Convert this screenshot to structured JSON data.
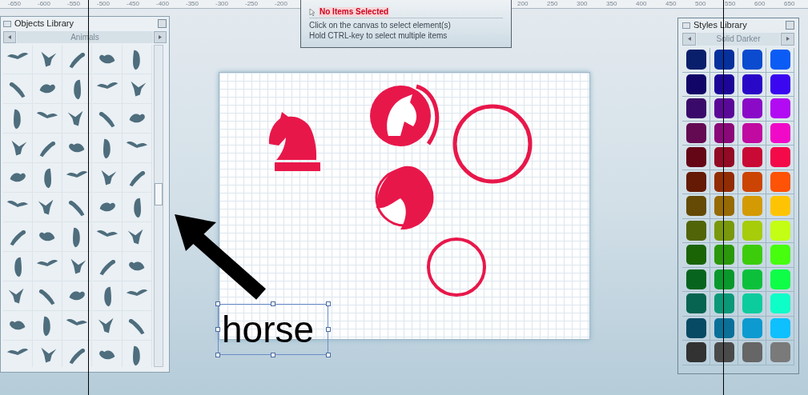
{
  "ruler": {
    "left_labels": [
      "-650",
      "-600",
      "-550",
      "-500",
      "-450",
      "-400",
      "-350",
      "-300",
      "-250",
      "-200"
    ],
    "right_labels": [
      "200",
      "250",
      "300",
      "350",
      "400",
      "450",
      "500",
      "550",
      "600",
      "650"
    ]
  },
  "objects_library": {
    "title": "Objects Library",
    "category": "Animals"
  },
  "selection_panel": {
    "status": "No Items Selected",
    "hints": [
      "Click on the canvas to select element(s)",
      "Hold CTRL-key to select multiple items"
    ]
  },
  "canvas": {
    "text_object": {
      "text": "horse",
      "selected": true
    }
  },
  "styles_library": {
    "title": "Styles Library",
    "category": "Solid Darker",
    "swatches": [
      {
        "color": "#0a1f6b"
      },
      {
        "color": "#06309c"
      },
      {
        "color": "#0a4bd0"
      },
      {
        "color": "#0b5cf5"
      },
      {
        "color": "#110667"
      },
      {
        "color": "#1c0698"
      },
      {
        "color": "#2a08c8"
      },
      {
        "color": "#3a07f0"
      },
      {
        "color": "#3a0a6a"
      },
      {
        "color": "#5a0898"
      },
      {
        "color": "#8a0ac8"
      },
      {
        "color": "#b20af2"
      },
      {
        "color": "#640a52"
      },
      {
        "color": "#8a0878"
      },
      {
        "color": "#c00aa0"
      },
      {
        "color": "#f00ac8"
      },
      {
        "color": "#640616"
      },
      {
        "color": "#920a24"
      },
      {
        "color": "#c80a34"
      },
      {
        "color": "#f40a48"
      },
      {
        "color": "#641a04"
      },
      {
        "color": "#922c04"
      },
      {
        "color": "#cc4404"
      },
      {
        "color": "#fe5206"
      },
      {
        "color": "#644a04"
      },
      {
        "color": "#966a04"
      },
      {
        "color": "#d49a04"
      },
      {
        "color": "#fec404"
      },
      {
        "color": "#526408"
      },
      {
        "color": "#7a980c"
      },
      {
        "color": "#a6cc0a"
      },
      {
        "color": "#c4fe14"
      },
      {
        "color": "#1a6406"
      },
      {
        "color": "#2a980a"
      },
      {
        "color": "#3ccc0c"
      },
      {
        "color": "#46fe0e"
      },
      {
        "color": "#06641e"
      },
      {
        "color": "#0a982c"
      },
      {
        "color": "#0cc03c"
      },
      {
        "color": "#0efe48"
      },
      {
        "color": "#066450"
      },
      {
        "color": "#0a9878"
      },
      {
        "color": "#0ccc9e"
      },
      {
        "color": "#0efec8"
      },
      {
        "color": "#064a64"
      },
      {
        "color": "#0a7098"
      },
      {
        "color": "#0c9ad0"
      },
      {
        "color": "#0ec0fe"
      },
      {
        "color": "#323232"
      },
      {
        "color": "#4a4a4a"
      },
      {
        "color": "#666666"
      },
      {
        "color": "#7a7a7a"
      }
    ]
  }
}
